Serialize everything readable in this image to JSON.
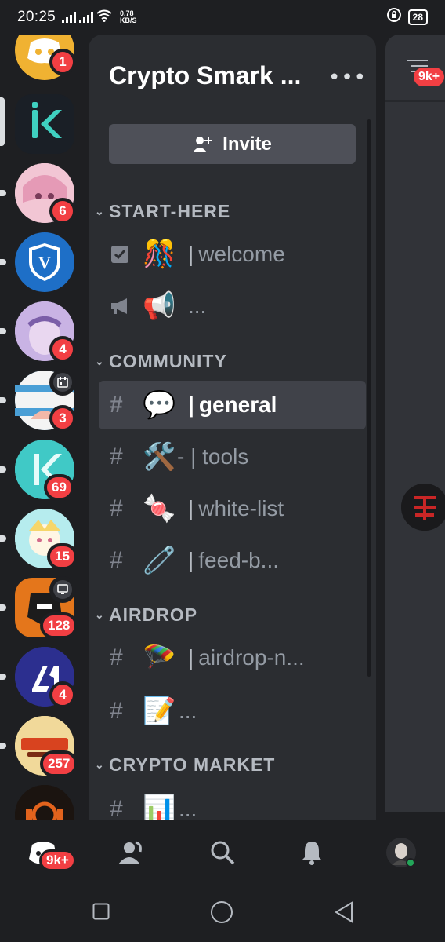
{
  "status_bar": {
    "time": "20:25",
    "speed_value": "0.78",
    "speed_unit": "KB/S",
    "battery": "28"
  },
  "servers": [
    {
      "icon": "discord-logo-icon",
      "color": "#f0b232",
      "badge": "1"
    },
    {
      "icon": "kaspa-k-logo-icon",
      "color": "#1a1f26",
      "badge": ""
    },
    {
      "icon": "anime-girl-avatar-icon",
      "color": "#f2c6d4",
      "badge": "6"
    },
    {
      "icon": "shield-v-logo-icon",
      "color": "#1e6fc7",
      "badge": ""
    },
    {
      "icon": "anime-avatar-icon",
      "color": "#b9a6d8",
      "badge": "4"
    },
    {
      "icon": "flag-avatar-icon",
      "color": "#4a9fd6",
      "badge": "3"
    },
    {
      "icon": "k-teal-logo-icon",
      "color": "#3fc7c4",
      "badge": "69"
    },
    {
      "icon": "cartoon-character-icon",
      "color": "#a3e3e6",
      "badge": "15"
    },
    {
      "icon": "gorilla-logo-icon",
      "color": "#e4761b",
      "badge": "128"
    },
    {
      "icon": "la-logo-icon",
      "color": "#2c2f8f",
      "badge": "4"
    },
    {
      "icon": "gunfire-logo-icon",
      "color": "#e7c77a",
      "badge": "257"
    },
    {
      "icon": "orange-glyph-logo-icon",
      "color": "#1b1410",
      "badge": ""
    }
  ],
  "panel": {
    "server_name": "Crypto Smark ...",
    "invite_label": "Invite"
  },
  "categories": [
    {
      "name": "START-HERE",
      "channels": [
        {
          "type": "rules",
          "emoji": "🎊",
          "sep": "|",
          "name": "welcome",
          "active": false
        },
        {
          "type": "announcement",
          "emoji": "📢",
          "sep": "",
          "name": "...",
          "active": false
        }
      ]
    },
    {
      "name": "COMMUNITY",
      "channels": [
        {
          "type": "text",
          "emoji": "💬",
          "sep": "|",
          "name": "general",
          "active": true
        },
        {
          "type": "text",
          "emoji": "🛠️",
          "sep": "",
          "name": "- | tools",
          "active": false
        },
        {
          "type": "text",
          "emoji": "🍬",
          "sep": "|",
          "name": "white-list",
          "active": false
        },
        {
          "type": "text",
          "emoji": "🧷",
          "sep": "|",
          "name": "feed-b...",
          "active": false
        }
      ]
    },
    {
      "name": "AIRDROP",
      "channels": [
        {
          "type": "text",
          "emoji": "🪂",
          "sep": "|",
          "name": "airdrop-n...",
          "active": false
        },
        {
          "type": "text",
          "emoji": "📝",
          "sep": "",
          "name": "...",
          "active": false
        }
      ]
    },
    {
      "name": "CRYPTO MARKET",
      "channels": [
        {
          "type": "text",
          "emoji": "📊",
          "sep": "",
          "name": "...",
          "active": false
        }
      ]
    }
  ],
  "peek": {
    "badge": "9k+"
  },
  "bottom_nav": {
    "home_badge": "9k+"
  },
  "colors": {
    "badge_red": "#f23f43",
    "panel_bg": "#2b2d31",
    "rail_bg": "#1e1f22",
    "active_bg": "#404249",
    "online_green": "#23a559"
  }
}
